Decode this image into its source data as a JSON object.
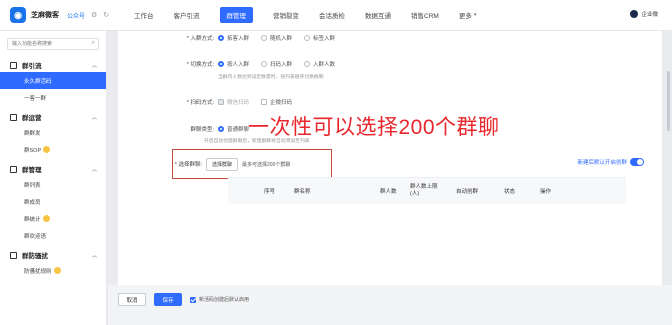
{
  "topbar": {
    "brand": "芝麻微客",
    "account": "公众号",
    "nav": [
      {
        "label": "工作台",
        "active": false,
        "caret": false
      },
      {
        "label": "客户引流",
        "active": false,
        "caret": false
      },
      {
        "label": "群管理",
        "active": true,
        "caret": false
      },
      {
        "label": "营销裂变",
        "active": false,
        "caret": false
      },
      {
        "label": "会话质检",
        "active": false,
        "caret": false
      },
      {
        "label": "数据互通",
        "active": false,
        "caret": false
      },
      {
        "label": "销售CRM",
        "active": false,
        "caret": false
      },
      {
        "label": "更多",
        "active": false,
        "caret": true
      }
    ],
    "user": "企业微"
  },
  "sidebar": {
    "search_placeholder": "输入功能名称搜索",
    "groups": [
      {
        "title": "群引流",
        "items": [
          {
            "label": "永久群活码",
            "active": true
          },
          {
            "label": "一客一群",
            "active": false
          }
        ]
      },
      {
        "title": "群运营",
        "items": [
          {
            "label": "群群发",
            "active": false
          },
          {
            "label": "群SOP",
            "active": false,
            "emoji": true
          }
        ]
      },
      {
        "title": "群管理",
        "items": [
          {
            "label": "群列表",
            "active": false
          },
          {
            "label": "群成员",
            "active": false
          },
          {
            "label": "群统计",
            "active": false,
            "emoji": true
          },
          {
            "label": "群欢迎语",
            "active": false
          }
        ]
      },
      {
        "title": "群防骚扰",
        "items": [
          {
            "label": "防骚扰规则",
            "active": false,
            "emoji": true
          }
        ]
      }
    ]
  },
  "form": {
    "join": {
      "label": "* 入群方式:",
      "options": [
        "拓客入群",
        "随机入群",
        "标签入群"
      ],
      "selected": 0
    },
    "switch": {
      "label": "* 切换方式:",
      "options": [
        "按人入群",
        "扫码入群",
        "入群人数"
      ],
      "selected": 0,
      "help": "当群内人数达到设定数量时，按列表顺序切换群聊"
    },
    "scan": {
      "label": "* 扫码方式:",
      "options": [
        "微信扫码",
        "企微扫码"
      ]
    },
    "grouptype": {
      "label": "群聊类型:",
      "options": [
        "普通群聊"
      ],
      "selected": 0,
      "help": "开启自动创建群聊后，新建群聊将自动添加至列表"
    },
    "select": {
      "label": "* 选择群聊:",
      "button": "选择群聊",
      "hint": "最多可选择200个群聊"
    },
    "auto_create": {
      "label": "新建后默认开启创群"
    },
    "overlay_text": "一次性可以选择200个群聊"
  },
  "table": {
    "headers": [
      "序号",
      "群名称",
      "群人数",
      "群人数上限",
      "自动创群",
      "状态",
      "操作"
    ],
    "header_sub": "(人)"
  },
  "footer": {
    "cancel": "取消",
    "save": "保存",
    "checkbox": "新活码创建后默认启用"
  }
}
